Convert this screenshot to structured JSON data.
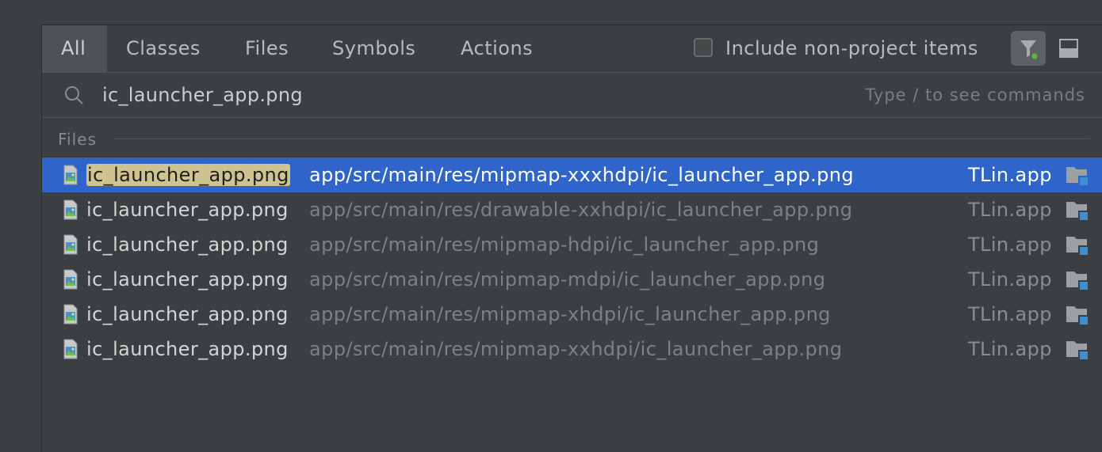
{
  "tabs": [
    {
      "label": "All",
      "active": true
    },
    {
      "label": "Classes",
      "active": false
    },
    {
      "label": "Files",
      "active": false
    },
    {
      "label": "Symbols",
      "active": false
    },
    {
      "label": "Actions",
      "active": false
    }
  ],
  "include_non_project": {
    "label": "Include non-project items",
    "checked": false
  },
  "toolbar": {
    "filter_icon": "filter-icon",
    "preview_icon": "preview-panel-icon"
  },
  "search": {
    "value": "ic_launcher_app.png",
    "hint": "Type / to see commands",
    "icon": "search-icon"
  },
  "group": {
    "title": "Files"
  },
  "results": [
    {
      "name": "ic_launcher_app.png",
      "path": "app/src/main/res/mipmap-xxxhdpi/ic_launcher_app.png",
      "module": "TLin.app",
      "selected": true
    },
    {
      "name": "ic_launcher_app.png",
      "path": "app/src/main/res/drawable-xxhdpi/ic_launcher_app.png",
      "module": "TLin.app",
      "selected": false
    },
    {
      "name": "ic_launcher_app.png",
      "path": "app/src/main/res/mipmap-hdpi/ic_launcher_app.png",
      "module": "TLin.app",
      "selected": false
    },
    {
      "name": "ic_launcher_app.png",
      "path": "app/src/main/res/mipmap-mdpi/ic_launcher_app.png",
      "module": "TLin.app",
      "selected": false
    },
    {
      "name": "ic_launcher_app.png",
      "path": "app/src/main/res/mipmap-xhdpi/ic_launcher_app.png",
      "module": "TLin.app",
      "selected": false
    },
    {
      "name": "ic_launcher_app.png",
      "path": "app/src/main/res/mipmap-xxhdpi/ic_launcher_app.png",
      "module": "TLin.app",
      "selected": false
    }
  ],
  "colors": {
    "selection": "#2f65ca",
    "highlight": "#cfc48f",
    "background": "#3c3f41"
  }
}
